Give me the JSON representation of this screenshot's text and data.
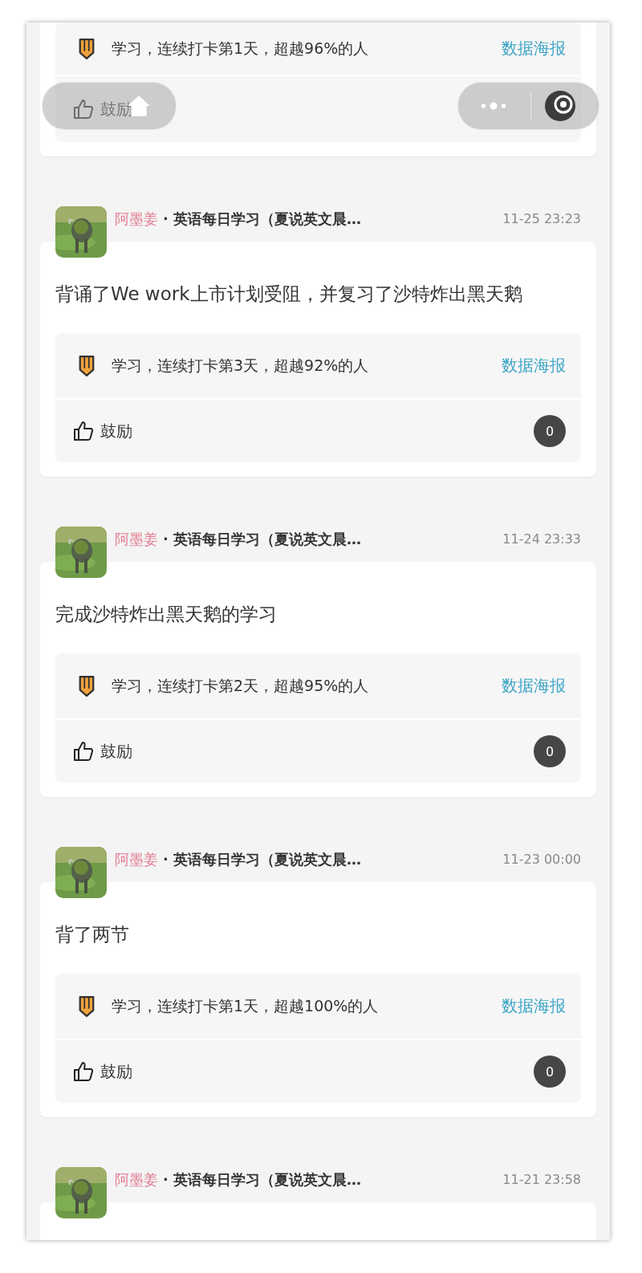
{
  "top_post": {
    "checkin": "学习，连续打卡第1天，超越96%的人",
    "poster_link": "数据海报",
    "like_label": "鼓励"
  },
  "posts": [
    {
      "author": "阿墨姜",
      "group": "· 英语每日学习（夏说英文晨…",
      "time": "11-25 23:23",
      "text": "背诵了We work上市计划受阻，并复习了沙特炸出黑天鹅",
      "checkin": "学习，连续打卡第3天，超越92%的人",
      "poster_link": "数据海报",
      "like_label": "鼓励",
      "count": "0"
    },
    {
      "author": "阿墨姜",
      "group": "· 英语每日学习（夏说英文晨…",
      "time": "11-24 23:33",
      "text": "完成沙特炸出黑天鹅的学习",
      "checkin": "学习，连续打卡第2天，超越95%的人",
      "poster_link": "数据海报",
      "like_label": "鼓励",
      "count": "0"
    },
    {
      "author": "阿墨姜",
      "group": "· 英语每日学习（夏说英文晨…",
      "time": "11-23 00:00",
      "text": "背了两节",
      "checkin": "学习，连续打卡第1天，超越100%的人",
      "poster_link": "数据海报",
      "like_label": "鼓励",
      "count": "0"
    },
    {
      "author": "阿墨姜",
      "group": "· 英语每日学习（夏说英文晨…",
      "time": "11-21 23:58"
    }
  ]
}
